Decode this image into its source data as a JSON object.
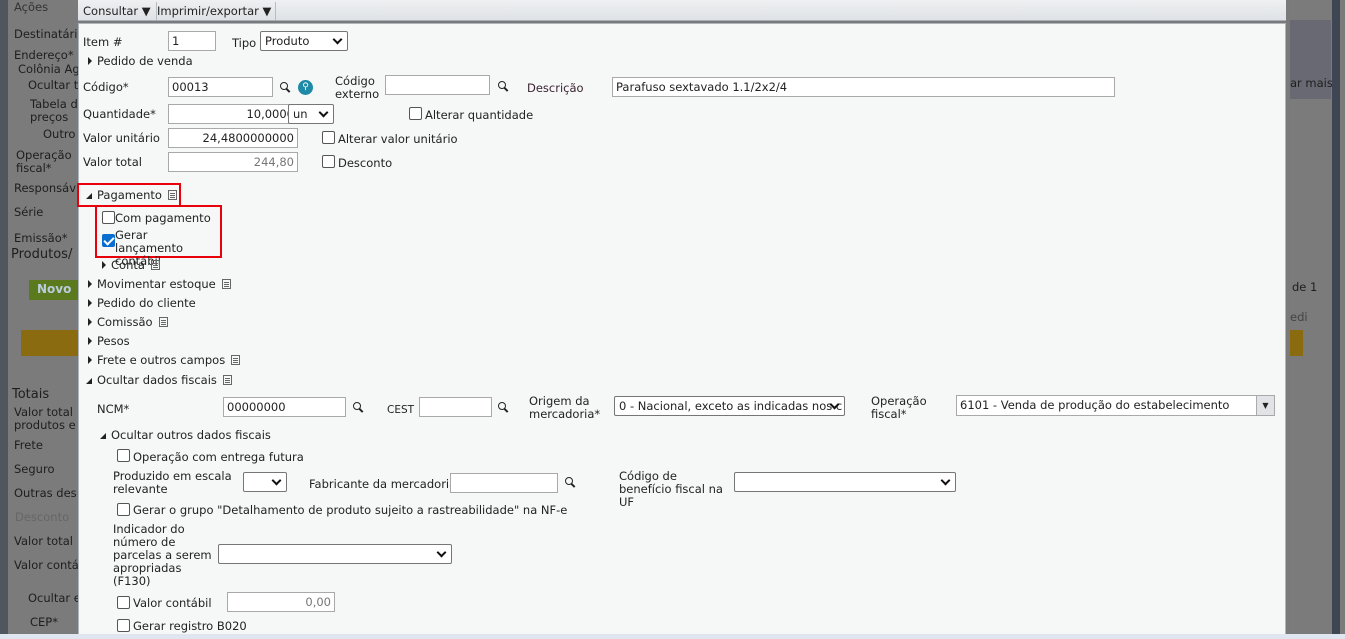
{
  "background": {
    "left_labels": [
      "Ações",
      "Destinatári",
      "Endereço*",
      "Colônia Ag",
      "Ocultar t",
      "Tabela d",
      "preços",
      "Outro",
      "Operação",
      "fiscal*",
      "Responsáv",
      "Série",
      "Emissão*",
      "Produtos/",
      "Novo",
      "Totais",
      "Valor total",
      "produtos e",
      "Frete",
      "Seguro",
      "Outras des",
      "Desconto",
      "Valor total",
      "Valor contá",
      "Ocultar e",
      "CEP*"
    ],
    "right_labels": [
      "ar mais",
      "de 1",
      "edi"
    ]
  },
  "toolbar": {
    "consultar": "Consultar",
    "imprimir": "Imprimir/exportar"
  },
  "form": {
    "item_label": "Item #",
    "item_value": "1",
    "tipo_label": "Tipo",
    "tipo_value": "Produto",
    "pedido_venda": "Pedido de venda",
    "codigo_label": "Código*",
    "codigo_value": "00013",
    "codigo_externo_label": "Código externo",
    "codigo_externo_value": "",
    "descricao_label": "Descrição",
    "descricao_value": "Parafuso sextavado 1.1/2x2/4",
    "quantidade_label": "Quantidade*",
    "quantidade_value": "10,0000",
    "unidade_value": "un",
    "alterar_quantidade": "Alterar quantidade",
    "valor_unitario_label": "Valor unitário",
    "valor_unitario_value": "24,4800000000",
    "alterar_valor_unitario": "Alterar valor unitário",
    "valor_total_label": "Valor total",
    "valor_total_value": "244,80",
    "desconto": "Desconto"
  },
  "pagamento": {
    "title": "Pagamento",
    "com_pagamento": "Com pagamento",
    "com_pagamento_checked": false,
    "gerar_lancamento": "Gerar lançamento contábil",
    "gerar_lancamento_checked": true,
    "conta": "Conta"
  },
  "sections": [
    "Movimentar estoque",
    "Pedido do cliente",
    "Comissão",
    "Pesos",
    "Frete e outros campos",
    "Ocultar dados fiscais"
  ],
  "fiscal": {
    "ncm_label": "NCM*",
    "ncm_value": "00000000",
    "cest_label": "CEST",
    "cest_value": "",
    "origem_label": "Origem da mercadoria*",
    "origem_value": "0 - Nacional, exceto as indicadas nos c",
    "operacao_label": "Operação fiscal*",
    "operacao_value": "6101 - Venda de produção do estabelecimento",
    "outros": "Ocultar outros dados fiscais",
    "entrega_futura": "Operação com entrega futura",
    "escala_label": "Produzido em escala relevante",
    "escala_value": "",
    "fabricante_label": "Fabricante da mercadoria",
    "fabricante_value": "",
    "beneficio_label": "Código de benefício fiscal na UF",
    "beneficio_value": "",
    "rastreabilidade": "Gerar o grupo \"Detalhamento de produto sujeito a rastreabilidade\" na NF-e",
    "indicador_label": "Indicador do número de parcelas a serem apropriadas (F130)",
    "indicador_value": "",
    "valor_contabil": "Valor contábil",
    "valor_contabil_value": "0,00",
    "b020": "Gerar registro B020"
  }
}
